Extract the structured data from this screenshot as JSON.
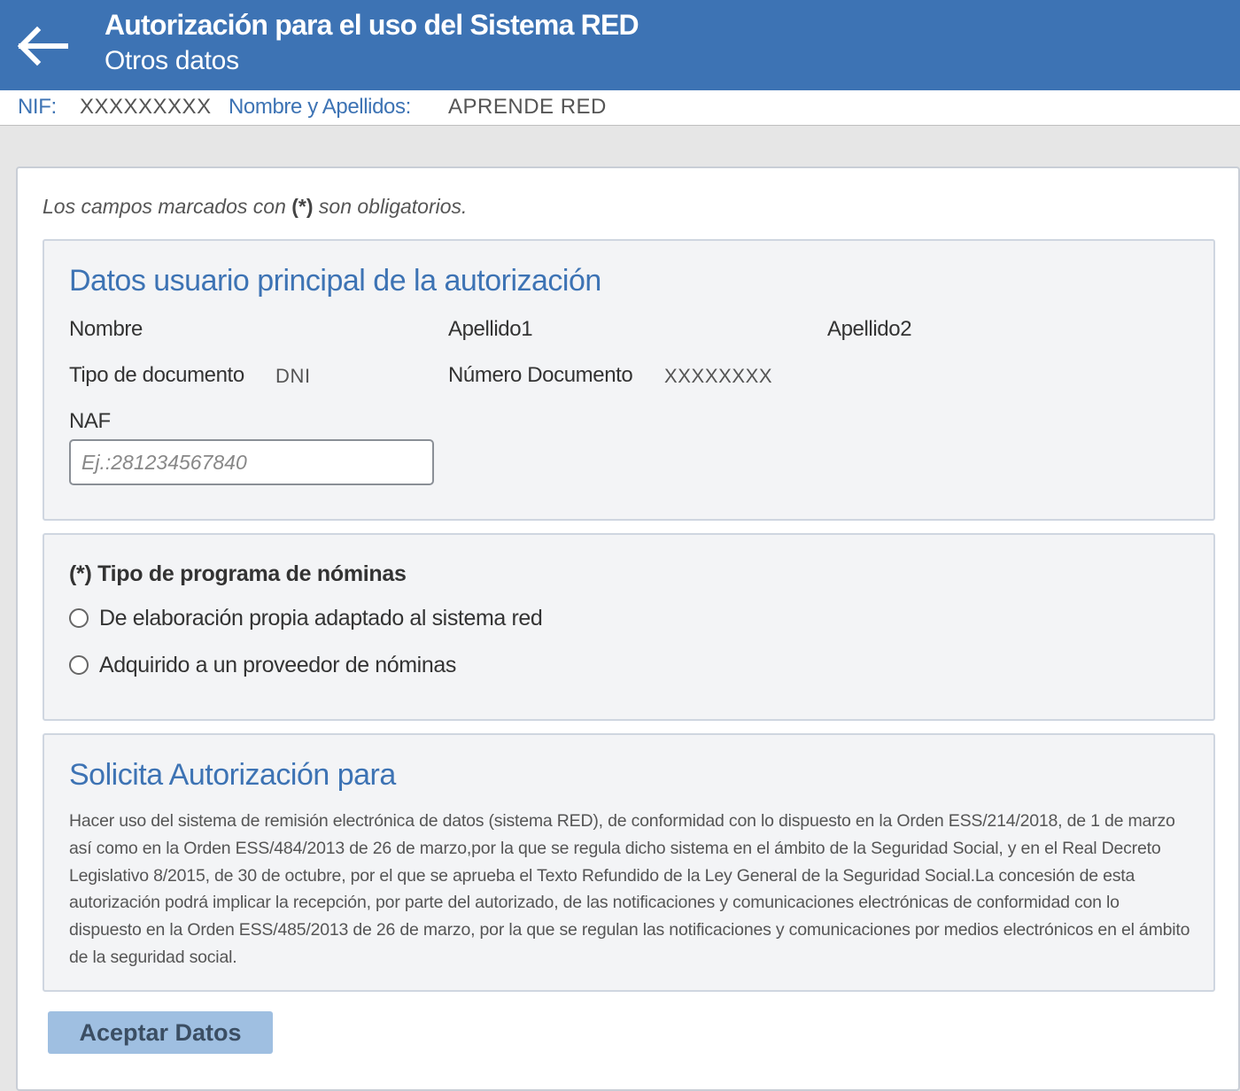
{
  "header": {
    "back_icon": "arrow-left-icon",
    "title": "Autorización para el uso del Sistema RED",
    "subtitle": "Otros datos"
  },
  "identity": {
    "nif_label": "NIF:",
    "nif_value": "XXXXXXXXX",
    "name_label": "Nombre y Apellidos:",
    "name_value": "APRENDE RED"
  },
  "form": {
    "required_note_prefix": "Los campos marcados con",
    "required_marker": "(*)",
    "required_note_suffix": "son obligatorios.",
    "principal": {
      "title": "Datos usuario principal de la autorización",
      "nombre_label": "Nombre",
      "apellido1_label": "Apellido1",
      "apellido2_label": "Apellido2",
      "tipo_doc_label": "Tipo de documento",
      "tipo_doc_value": "DNI",
      "num_doc_label": "Número Documento",
      "num_doc_value": "XXXXXXXX",
      "naf_label": "NAF",
      "naf_placeholder": "Ej.:281234567840",
      "naf_value": ""
    },
    "nominas": {
      "heading": "(*) Tipo de programa de nóminas",
      "options": [
        {
          "label": "De elaboración propia adaptado al sistema red",
          "selected": false
        },
        {
          "label": "Adquirido a un proveedor de nóminas",
          "selected": false
        }
      ]
    },
    "solicita": {
      "title": "Solicita Autorización para",
      "text": "Hacer uso del sistema de remisión electrónica de datos (sistema RED), de conformidad con lo dispuesto en la Orden ESS/214/2018, de 1 de marzo así como en la Orden ESS/484/2013 de 26 de marzo,por la que se regula dicho sistema en el ámbito de la Seguridad Social, y en el Real Decreto Legislativo 8/2015, de 30 de octubre, por el que se aprueba el Texto Refundido de la Ley General de la Seguridad Social.La concesión de esta autorización podrá implicar la recepción, por parte del autorizado, de las notificaciones y comunicaciones electrónicas de conformidad con lo dispuesto en la Orden ESS/485/2013 de 26 de marzo, por la que se regulan las notificaciones y comunicaciones por medios electrónicos en el ámbito de la seguridad social."
    },
    "accept_label": "Aceptar Datos"
  },
  "colors": {
    "header_bg": "#3d73b4",
    "accent_text": "#3d73b4",
    "button_bg": "#9fbfe1"
  }
}
